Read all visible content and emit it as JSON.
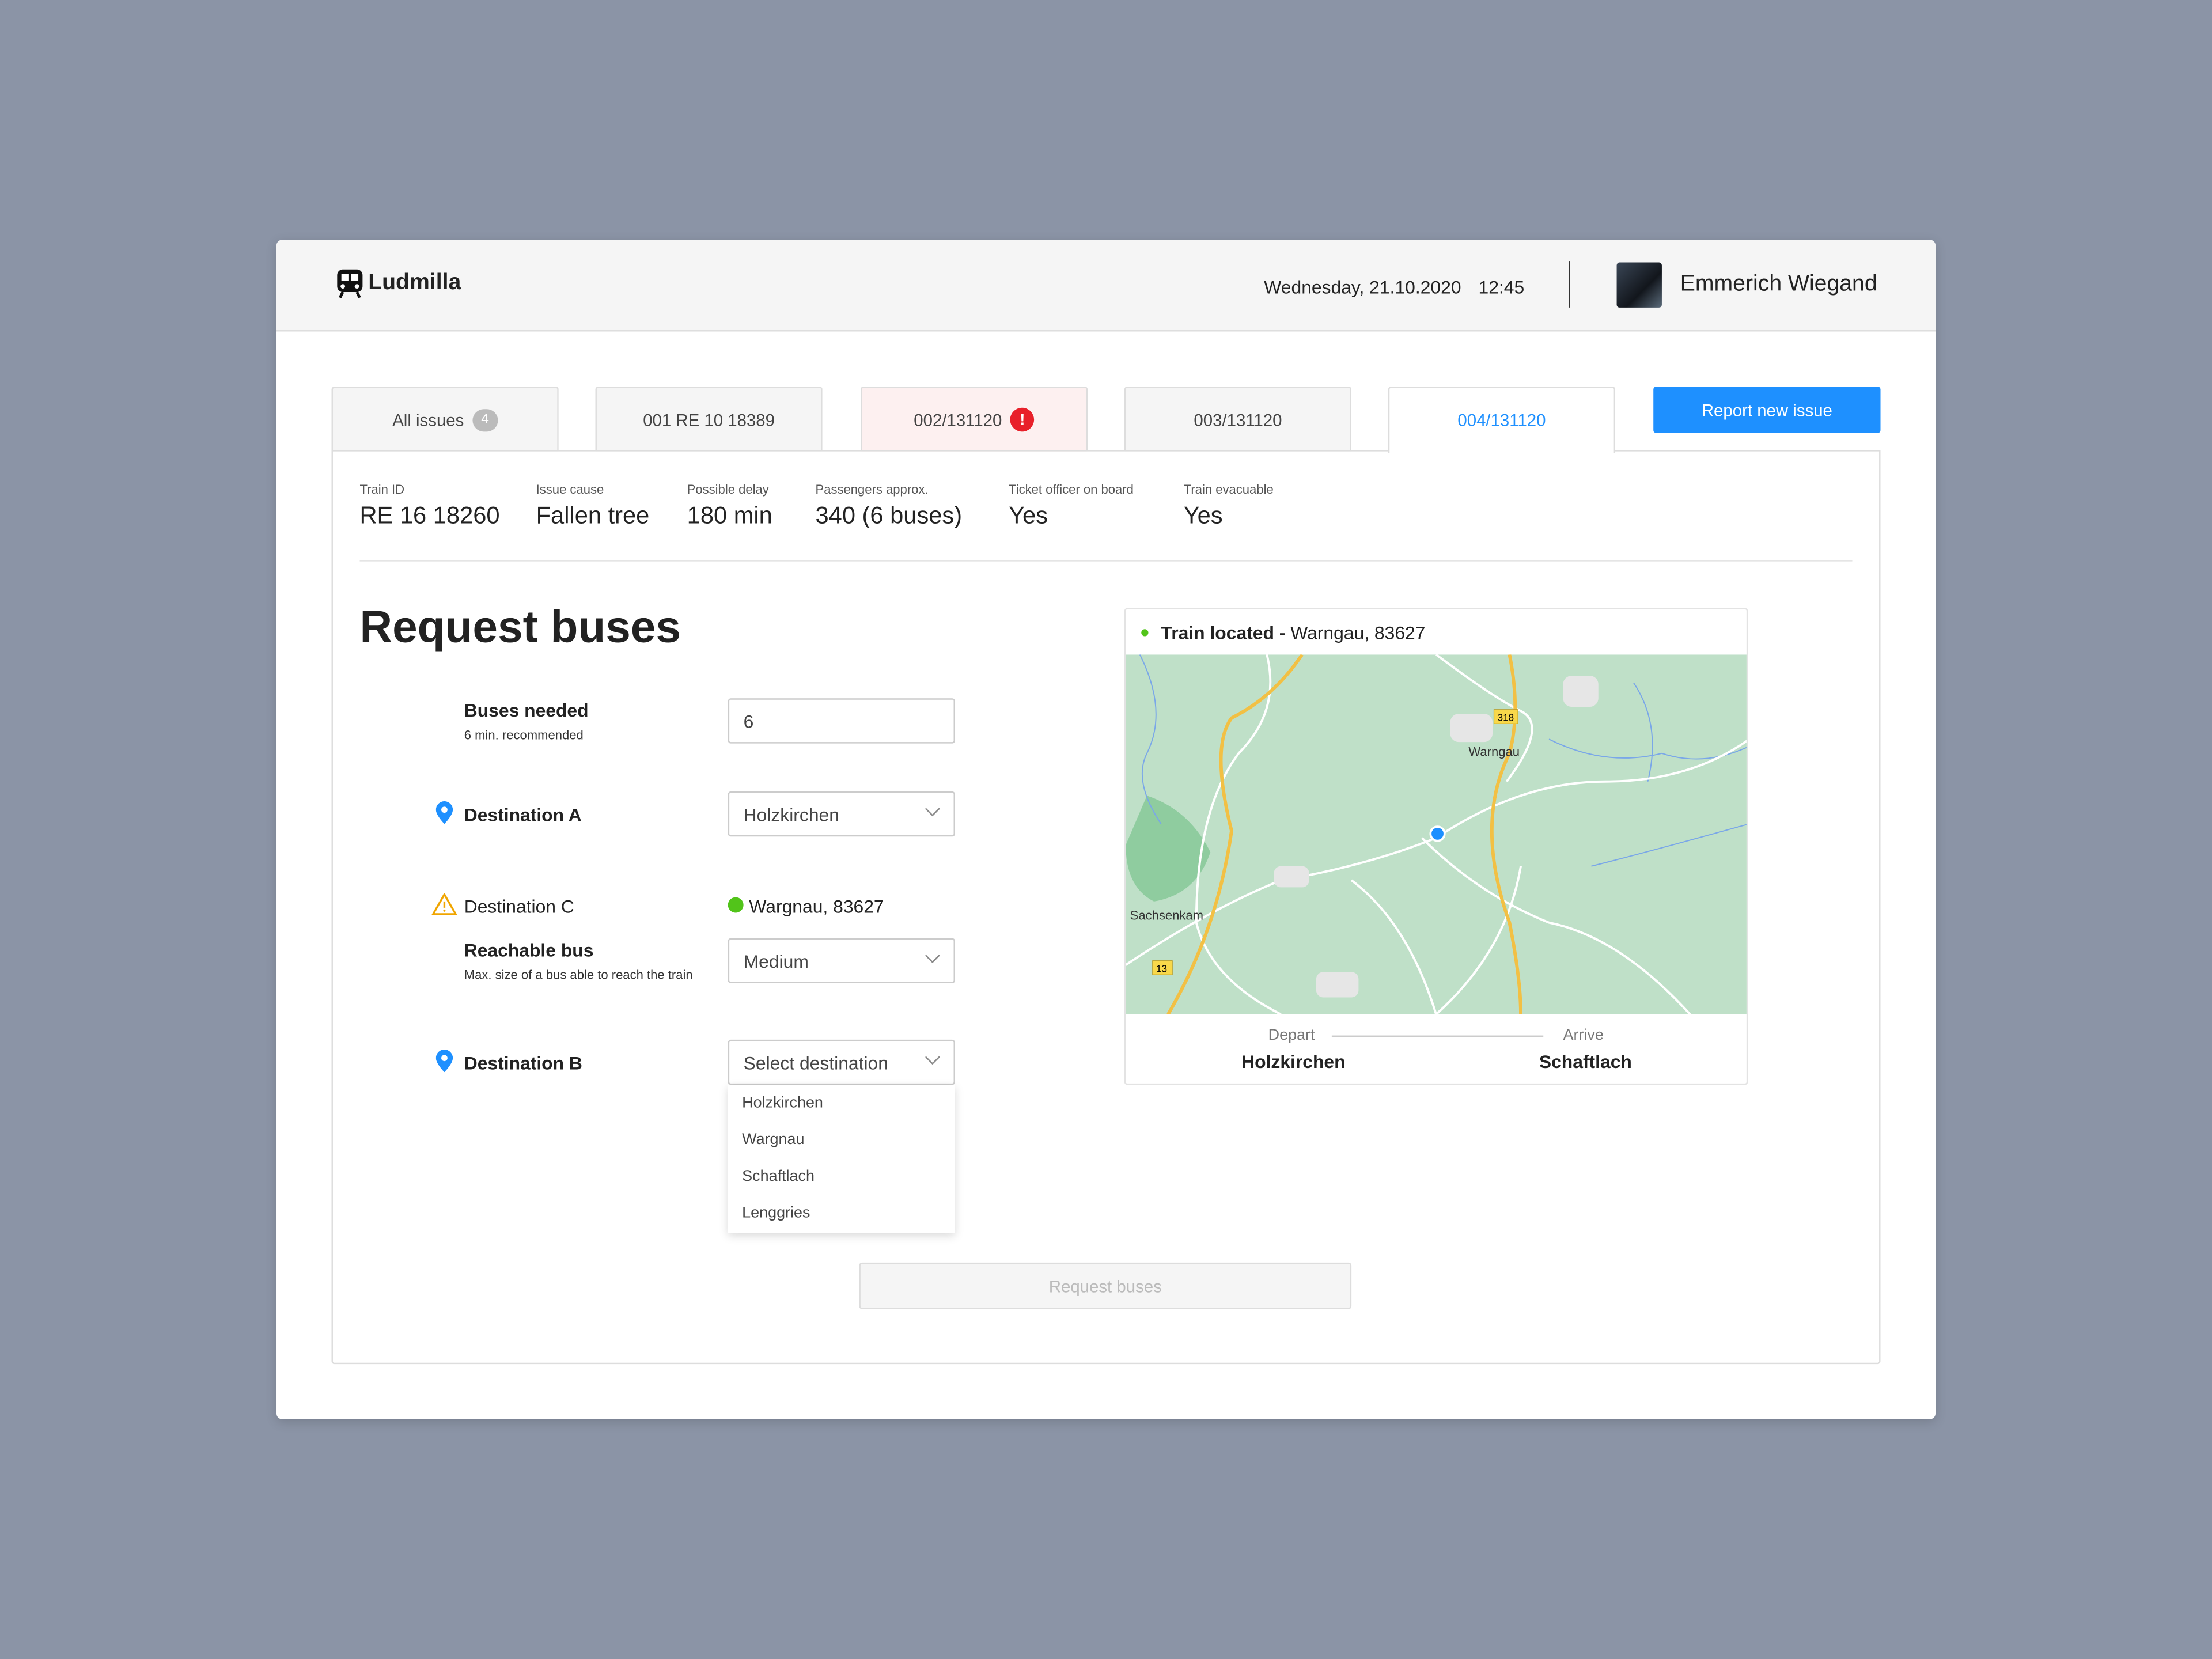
{
  "app": {
    "name": "Ludmilla",
    "date": "Wednesday, 21.10.2020",
    "time": "12:45",
    "user": "Emmerich Wiegand"
  },
  "tabs": [
    {
      "label": "All issues",
      "badge": "4"
    },
    {
      "label": "001 RE 10 18389"
    },
    {
      "label": "002/131120",
      "alert": "!"
    },
    {
      "label": "003/131120"
    },
    {
      "label": "004/131120",
      "active": true
    }
  ],
  "report_button": "Report new issue",
  "summary": [
    {
      "label": "Train ID",
      "value": "RE 16 18260"
    },
    {
      "label": "Issue cause",
      "value": "Fallen tree"
    },
    {
      "label": "Possible delay",
      "value": "180 min"
    },
    {
      "label": "Passengers approx.",
      "value": "340 (6 buses)"
    },
    {
      "label": "Ticket officer on board",
      "value": "Yes"
    },
    {
      "label": "Train evacuable",
      "value": "Yes"
    }
  ],
  "form": {
    "title": "Request buses",
    "buses_needed": {
      "label": "Buses needed",
      "hint": "6 min. recommended",
      "value": "6"
    },
    "dest_a": {
      "label": "Destination A",
      "value": "Holzkirchen"
    },
    "dest_c": {
      "label": "Destination C",
      "value": "Wargnau, 83627"
    },
    "reachable": {
      "label": "Reachable bus",
      "hint": "Max. size of a bus able to reach the train",
      "value": "Medium"
    },
    "dest_b": {
      "label": "Destination B",
      "placeholder": "Select destination",
      "options": [
        "Holzkirchen",
        "Wargnau",
        "Schaftlach",
        "Lenggries"
      ]
    },
    "submit": "Request buses"
  },
  "map": {
    "title_bold": "Train located - ",
    "title": "Warngau, 83627",
    "labels": [
      "Warngau",
      "Sachsenkam"
    ],
    "shields": [
      "318",
      "13"
    ],
    "depart_label": "Depart",
    "depart": "Holzkirchen",
    "arrive_label": "Arrive",
    "arrive": "Schaftlach"
  },
  "colors": {
    "accent": "#1e90ff",
    "alert": "#e8202a",
    "warning": "#f0a500",
    "ok": "#52c41a",
    "map": "#bfe0c8"
  }
}
